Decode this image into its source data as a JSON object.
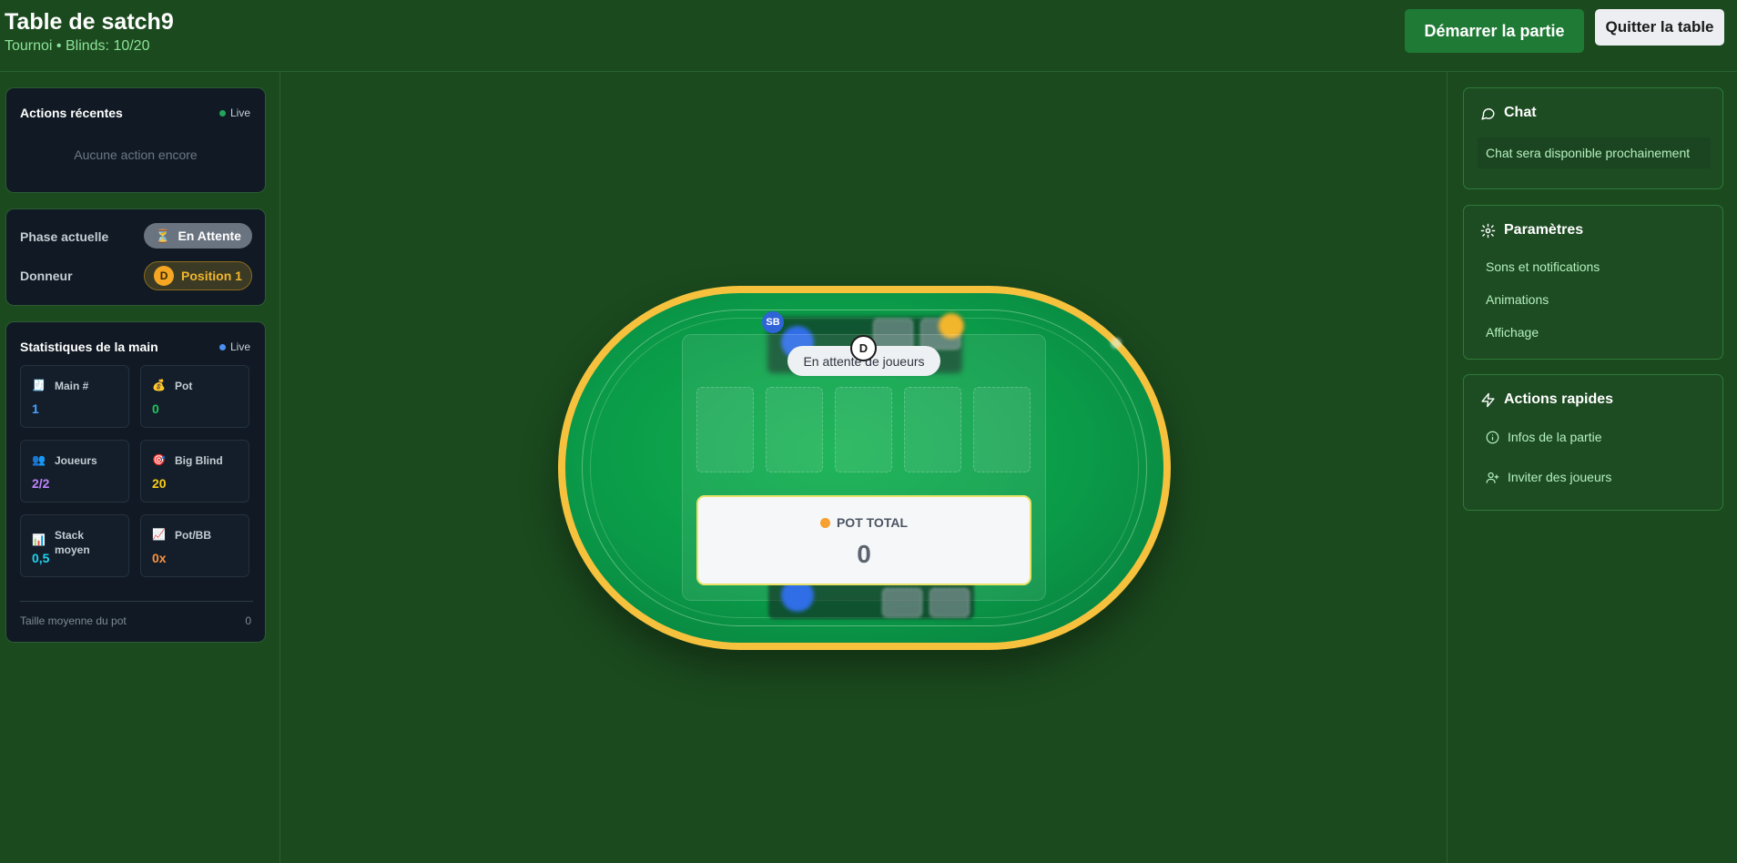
{
  "header": {
    "title": "Table de satch9",
    "subtitle": "Tournoi • Blinds: 10/20",
    "start_button": "Démarrer la partie",
    "quit_button": "Quitter la table"
  },
  "recent_actions": {
    "title": "Actions récentes",
    "live": "Live",
    "empty": "Aucune action encore"
  },
  "phase": {
    "phase_label": "Phase actuelle",
    "phase_value": "En Attente",
    "phase_icon": "hourglass-icon",
    "dealer_label": "Donneur",
    "dealer_badge": "D",
    "dealer_value": "Position 1"
  },
  "hand_stats": {
    "title": "Statistiques de la main",
    "live": "Live",
    "items": [
      {
        "icon": "page-icon",
        "label": "Main #",
        "value": "1",
        "color": "#4aa3ff"
      },
      {
        "icon": "money-bag-icon",
        "label": "Pot",
        "value": "0",
        "color": "#22c55e"
      },
      {
        "icon": "users-icon",
        "label": "Joueurs",
        "value": "2/2",
        "color": "#c084fc"
      },
      {
        "icon": "target-icon",
        "label": "Big Blind",
        "value": "20",
        "color": "#facc15"
      },
      {
        "icon": "bar-chart-icon",
        "label": "Stack moyen",
        "value": "0,5",
        "color": "#22d3ee"
      },
      {
        "icon": "trend-chart-icon",
        "label": "Pot/BB",
        "value": "0x",
        "color": "#fb923c"
      }
    ],
    "footer_label": "Taille moyenne du pot",
    "footer_value": "0"
  },
  "table": {
    "waiting_text": "En attente de joueurs",
    "dealer_button": "D",
    "small_blind_badge": "SB",
    "pot_label": "POT TOTAL",
    "pot_value": "0"
  },
  "chat": {
    "title": "Chat",
    "message": "Chat sera disponible prochainement"
  },
  "settings": {
    "title": "Paramètres",
    "items": [
      "Sons et notifications",
      "Animations",
      "Affichage"
    ]
  },
  "quick_actions": {
    "title": "Actions rapides",
    "items": [
      {
        "icon": "info-icon",
        "label": "Infos de la partie"
      },
      {
        "icon": "user-plus-icon",
        "label": "Inviter des joueurs"
      }
    ]
  }
}
